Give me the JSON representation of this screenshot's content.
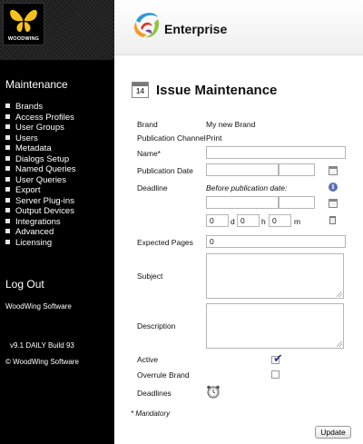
{
  "sidebar": {
    "logo_text": "WOODWING",
    "section_title": "Maintenance",
    "items": [
      {
        "label": "Brands"
      },
      {
        "label": "Access Profiles"
      },
      {
        "label": "User Groups"
      },
      {
        "label": "Users"
      },
      {
        "label": "Metadata"
      },
      {
        "label": "Dialogs Setup"
      },
      {
        "label": "Named Queries"
      },
      {
        "label": "User Queries"
      },
      {
        "label": "Export"
      },
      {
        "label": "Server Plug-ins"
      },
      {
        "label": "Output Devices"
      },
      {
        "label": "Integrations"
      },
      {
        "label": "Advanced"
      },
      {
        "label": "Licensing"
      }
    ],
    "logout_label": "Log Out",
    "company": "WoodWing Software",
    "build": "v9.1 DAILY Build 93",
    "copyright": "© WoodWing Software"
  },
  "header": {
    "product_name": "Enterprise"
  },
  "page": {
    "title": "Issue Maintenance",
    "calendar_number": "14"
  },
  "form": {
    "brand_label": "Brand",
    "brand_value": "My new Brand",
    "channel_label": "Publication Channel",
    "channel_value": "Print",
    "name_label": "Name*",
    "name_value": "",
    "pubdate_label": "Publication Date",
    "pubdate_date_value": "",
    "pubdate_time_value": "",
    "deadline_label": "Deadline",
    "deadline_before_label": "Before publication date:",
    "deadline_date_value": "",
    "deadline_time_value": "",
    "deadline_days": "0",
    "deadline_days_unit": "d",
    "deadline_hours": "0",
    "deadline_hours_unit": "h",
    "deadline_minutes": "0",
    "deadline_minutes_unit": "m",
    "expected_pages_label": "Expected Pages",
    "expected_pages_value": "0",
    "subject_label": "Subject",
    "description_label": "Description",
    "active_label": "Active",
    "active_checked": true,
    "overrule_label": "Overrule Brand",
    "overrule_checked": false,
    "deadlines_label": "Deadlines",
    "mandatory_note": "* Mandatory",
    "update_label": "Update"
  },
  "icons": {
    "logo": "woodwing-butterfly-icon",
    "enterprise": "enterprise-swirl-icon",
    "calendar": "calendar-icon",
    "info": "info-icon",
    "trash": "trash-icon",
    "clock": "alarm-clock-icon"
  },
  "colors": {
    "sidebar_bg": "#000000",
    "logo_yellow": "#f5c21b",
    "checkmark": "#243c8a"
  }
}
